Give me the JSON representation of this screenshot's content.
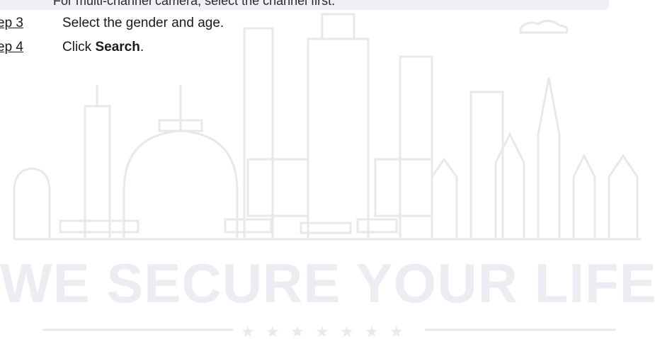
{
  "header_line": "For multi-channel camera, select the channel first.",
  "steps": [
    {
      "label": "ep 3",
      "text": "Select the gender and age."
    },
    {
      "label": "ep 4",
      "text_prefix": "Click ",
      "text_bold": "Search",
      "text_suffix": "."
    }
  ],
  "watermark": {
    "slogan": "WE SECURE YOUR LIFE",
    "color": "#ebedf2"
  }
}
